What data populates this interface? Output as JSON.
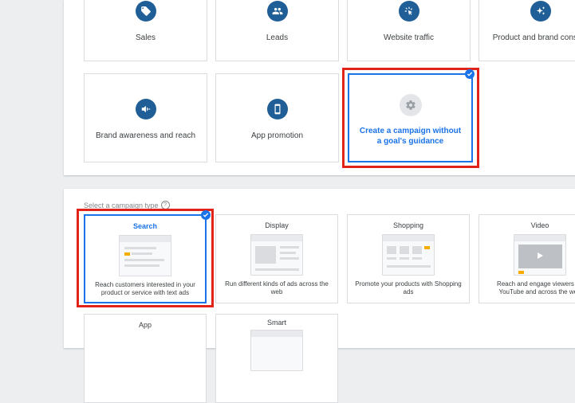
{
  "goals": {
    "row1": [
      "Sales",
      "Leads",
      "Website traffic",
      "Product and brand conside"
    ],
    "row2": [
      "Brand awareness and reach",
      "App promotion",
      "Create a campaign without a goal's guidance"
    ]
  },
  "campaign_types": {
    "section_label": "Select a campaign type",
    "help_glyph": "?",
    "cards": [
      {
        "title": "Search",
        "desc": "Reach customers interested in your product or service with text ads"
      },
      {
        "title": "Display",
        "desc": "Run different kinds of ads across the web"
      },
      {
        "title": "Shopping",
        "desc": "Promote your products with Shopping ads"
      },
      {
        "title": "Video",
        "desc": "Reach and engage viewers on YouTube and across the web"
      },
      {
        "title": "App",
        "desc": ""
      },
      {
        "title": "Smart",
        "desc": ""
      }
    ]
  },
  "colors": {
    "accent": "#1a73e8",
    "highlight": "#e2231a",
    "icon_bg": "#1f5e96"
  }
}
